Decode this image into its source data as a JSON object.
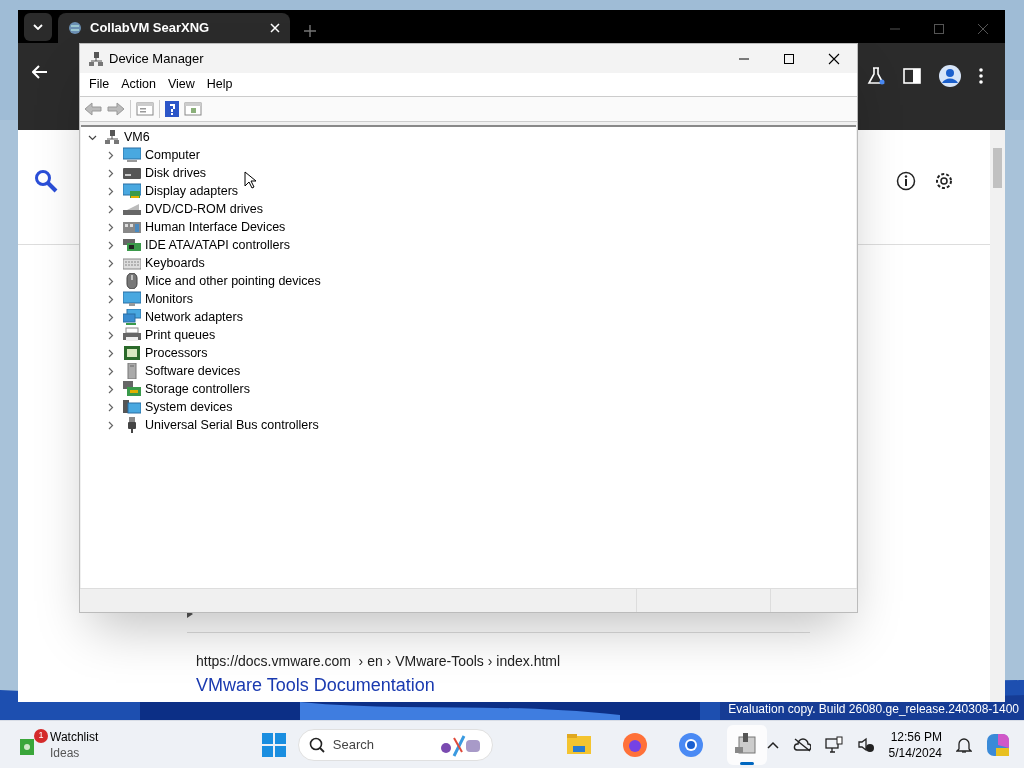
{
  "desktop": {
    "watermark": "Evaluation copy. Build 26080.ge_release.240308-1400"
  },
  "browser": {
    "tabs": [
      {
        "title": "CollabVM SearXNG",
        "selected": true
      }
    ],
    "page": {
      "result": {
        "url": "https://docs.vmware.com  › en › VMware-Tools › index.html",
        "title": "VMware Tools Documentation"
      }
    }
  },
  "device_manager": {
    "title": "Device Manager",
    "menu": [
      "File",
      "Action",
      "View",
      "Help"
    ],
    "tree": {
      "label": "VM6",
      "expanded": true,
      "children": [
        {
          "label": "Computer",
          "kind": "computer",
          "expanded": false
        },
        {
          "label": "Disk drives",
          "kind": "disk",
          "expanded": false
        },
        {
          "label": "Display adapters",
          "kind": "display",
          "expanded": false
        },
        {
          "label": "DVD/CD-ROM drives",
          "kind": "dvd",
          "expanded": false
        },
        {
          "label": "Human Interface Devices",
          "kind": "hid",
          "expanded": false
        },
        {
          "label": "IDE ATA/ATAPI controllers",
          "kind": "ide",
          "expanded": false
        },
        {
          "label": "Keyboards",
          "kind": "keyboard",
          "expanded": false
        },
        {
          "label": "Mice and other pointing devices",
          "kind": "mouse",
          "expanded": false
        },
        {
          "label": "Monitors",
          "kind": "monitor",
          "expanded": false
        },
        {
          "label": "Network adapters",
          "kind": "network",
          "expanded": false
        },
        {
          "label": "Print queues",
          "kind": "printer",
          "expanded": false
        },
        {
          "label": "Processors",
          "kind": "processor",
          "expanded": false
        },
        {
          "label": "Software devices",
          "kind": "software",
          "expanded": false
        },
        {
          "label": "Storage controllers",
          "kind": "storage",
          "expanded": false
        },
        {
          "label": "System devices",
          "kind": "system",
          "expanded": false
        },
        {
          "label": "Universal Serial Bus controllers",
          "kind": "usb",
          "expanded": false
        }
      ]
    }
  },
  "taskbar": {
    "widget": {
      "title": "Watchlist",
      "subtitle": "Ideas",
      "badge": "1"
    },
    "search_label": "Search",
    "apps": [
      {
        "kind": "files",
        "selected": false
      },
      {
        "kind": "firefox",
        "selected": false
      },
      {
        "kind": "chrome",
        "selected": false
      },
      {
        "kind": "devmgr",
        "selected": true
      }
    ],
    "clock": {
      "time": "12:56 PM",
      "date": "5/14/2024"
    }
  }
}
